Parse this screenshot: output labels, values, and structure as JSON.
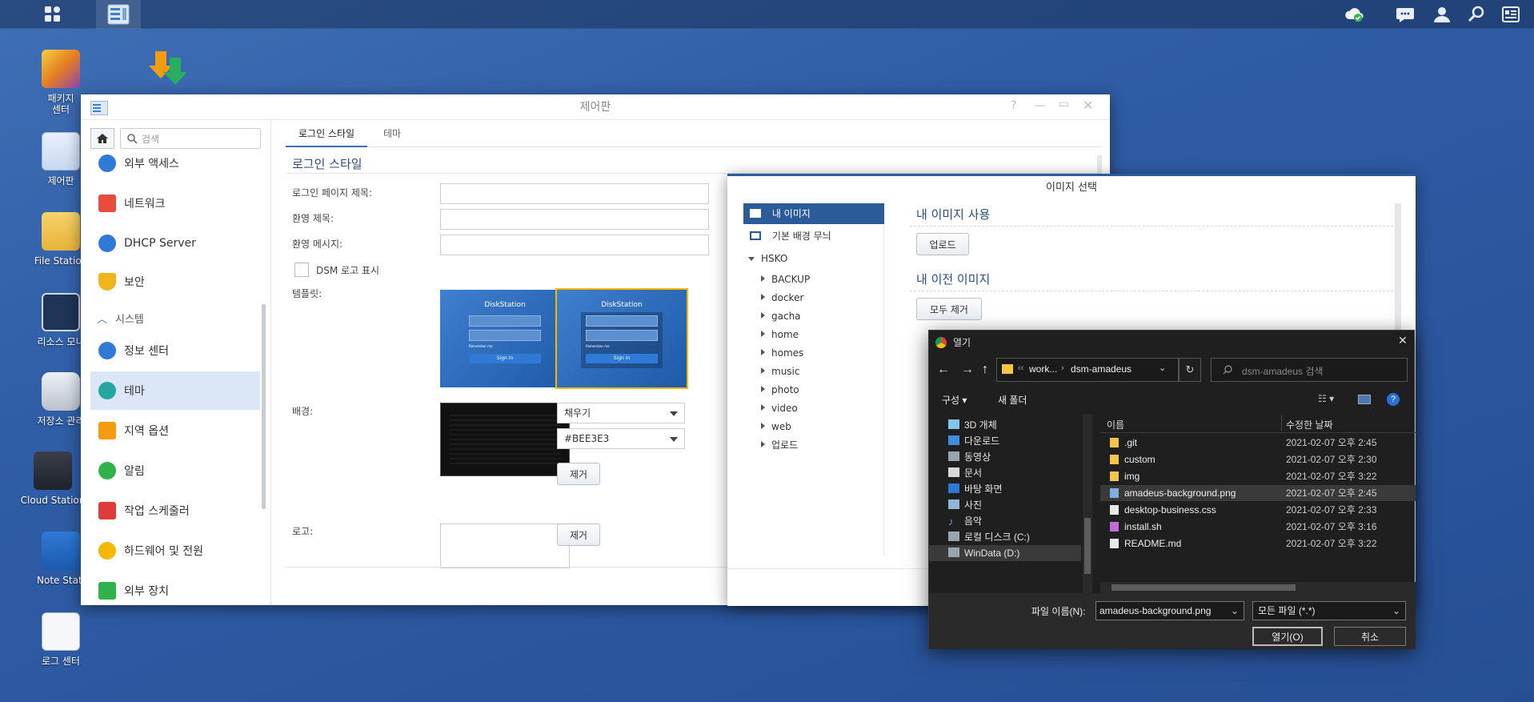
{
  "taskbar": {
    "icons": [
      "apps-grid-icon",
      "control-panel-icon",
      "cloud-sync-icon",
      "chat-icon",
      "user-icon",
      "search-icon",
      "widgets-icon"
    ]
  },
  "desktop": {
    "icons": [
      {
        "label": "패키지\n센터"
      },
      {
        "label": ""
      },
      {
        "label": "제어판"
      },
      {
        "label": "File Station"
      },
      {
        "label": "리소스 모니"
      },
      {
        "label": "저장소 관리"
      },
      {
        "label": "Cloud Station"
      },
      {
        "label": "Note Stati"
      },
      {
        "label": "로그 센터"
      }
    ]
  },
  "control_panel": {
    "title": "제어판",
    "search_placeholder": "검색",
    "sidebar": {
      "items": [
        {
          "label": "외부 액세스"
        },
        {
          "label": "네트워크"
        },
        {
          "label": "DHCP Server"
        },
        {
          "label": "보안"
        },
        {
          "label": "시스템"
        },
        {
          "label": "정보 센터"
        },
        {
          "label": "테마"
        },
        {
          "label": "지역 옵션"
        },
        {
          "label": "알림"
        },
        {
          "label": "작업 스케줄러"
        },
        {
          "label": "하드웨어 및 전원"
        },
        {
          "label": "외부 장치"
        }
      ]
    },
    "tabs": [
      {
        "label": "로그인 스타일"
      },
      {
        "label": "테마"
      }
    ],
    "section_title": "로그인 스타일",
    "fields": {
      "login_page_title": "로그인 페이지 제목:",
      "welcome_title": "환영 제목:",
      "welcome_message": "환영 메시지:",
      "show_dsm_logo": "DSM 로고 표시",
      "template": "템플릿:",
      "background": "배경:",
      "logo": "로고:"
    },
    "template_preview": {
      "title": "DiskStation",
      "remember": "Remember me",
      "signin": "Sign in"
    },
    "bg_mode": "채우기",
    "bg_color": "#BEE3E3",
    "remove_label": "제거"
  },
  "image_chooser": {
    "title": "이미지 선택",
    "nav": {
      "my_images": "내 이미지",
      "default_patterns": "기본 배경 무늬",
      "root": "HSKO",
      "folders": [
        "BACKUP",
        "docker",
        "gacha",
        "home",
        "homes",
        "music",
        "photo",
        "video",
        "web",
        "업로드"
      ]
    },
    "use_my_image": "내 이미지 사용",
    "upload": "업로드",
    "previous_images": "내 이전 이미지",
    "remove_all": "모두 제거"
  },
  "file_dialog": {
    "title": "열기",
    "path_prefix": "‹‹",
    "path": [
      "work...",
      "dsm-amadeus"
    ],
    "search_placeholder": "dsm-amadeus 검색",
    "organize": "구성",
    "new_folder": "새 폴더",
    "nav_items": [
      "3D 개체",
      "다운로드",
      "동영상",
      "문서",
      "바탕 화면",
      "사진",
      "음악",
      "로컬 디스크 (C:)",
      "WinData (D:)"
    ],
    "columns": {
      "name": "이름",
      "modified": "수정한 날짜"
    },
    "files": [
      {
        "name": ".git",
        "date": "2021-02-07 오후 2:45",
        "type": "folder"
      },
      {
        "name": "custom",
        "date": "2021-02-07 오후 2:30",
        "type": "folder"
      },
      {
        "name": "img",
        "date": "2021-02-07 오후 3:22",
        "type": "folder"
      },
      {
        "name": "amadeus-background.png",
        "date": "2021-02-07 오후 2:45",
        "type": "image"
      },
      {
        "name": "desktop-business.css",
        "date": "2021-02-07 오후 2:33",
        "type": "file"
      },
      {
        "name": "install.sh",
        "date": "2021-02-07 오후 3:16",
        "type": "script"
      },
      {
        "name": "README.md",
        "date": "2021-02-07 오후 3:22",
        "type": "file"
      }
    ],
    "filename_label": "파일 이름(N):",
    "filename_value": "amadeus-background.png",
    "filter_value": "모든 파일 (*.*)",
    "open_button": "열기(O)",
    "cancel_button": "취소"
  }
}
